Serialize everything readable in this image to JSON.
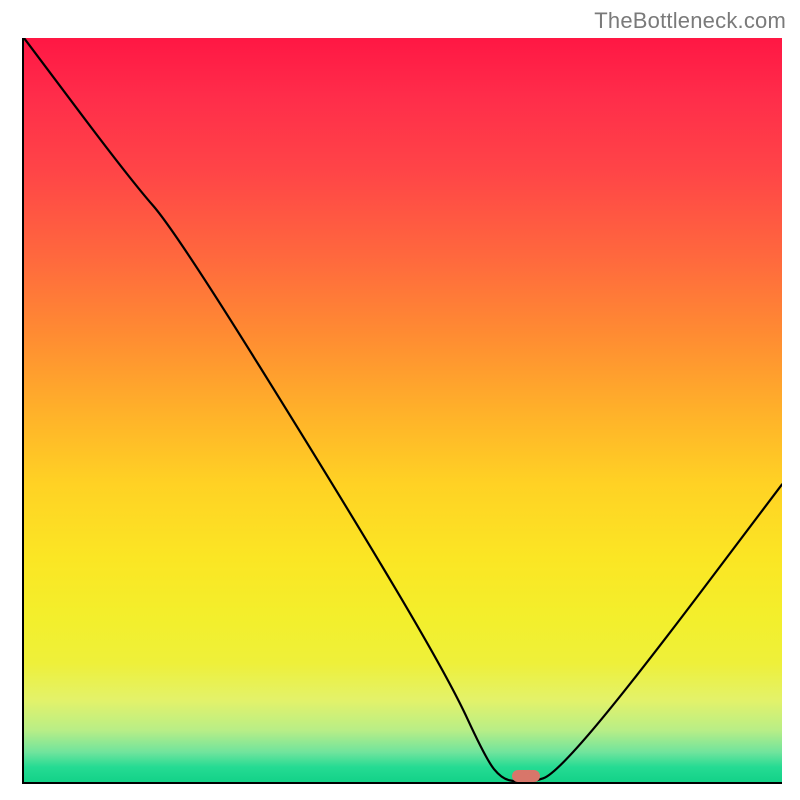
{
  "watermark": "TheBottleneck.com",
  "chart_data": {
    "type": "line",
    "title": "",
    "xlabel": "",
    "ylabel": "",
    "xlim": [
      0,
      100
    ],
    "ylim": [
      0,
      100
    ],
    "x": [
      0,
      14,
      20,
      42,
      56,
      61,
      63,
      65,
      67,
      70,
      80,
      100
    ],
    "values": [
      100,
      81,
      74,
      38,
      14,
      3,
      0.5,
      0,
      0,
      1,
      13,
      40
    ],
    "marker": {
      "x": 66,
      "y": 0
    },
    "colors": {
      "line": "#000000",
      "marker": "#d8766a",
      "gradient_top": "#ff1744",
      "gradient_bottom": "#13d288"
    },
    "grid": false
  }
}
